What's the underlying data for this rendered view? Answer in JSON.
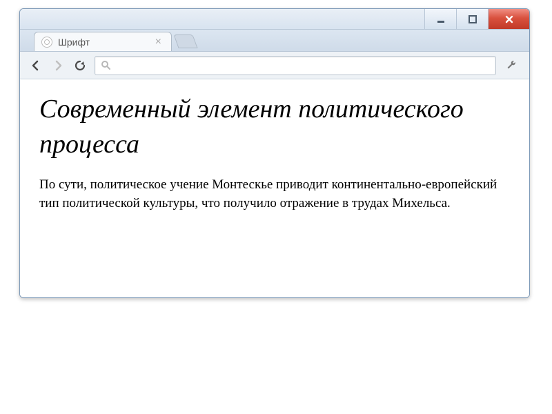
{
  "window": {
    "controls": {
      "minimize": "minimize",
      "maximize": "maximize",
      "close": "close"
    }
  },
  "tab": {
    "title": "Шрифт"
  },
  "omnibox": {
    "value": "",
    "placeholder": ""
  },
  "page": {
    "heading": "Современный элемент политического процесса",
    "paragraph": "По сути, политическое учение Монтескье приводит континентально-европейский тип политической культуры, что получило отражение в трудах Михельса."
  }
}
